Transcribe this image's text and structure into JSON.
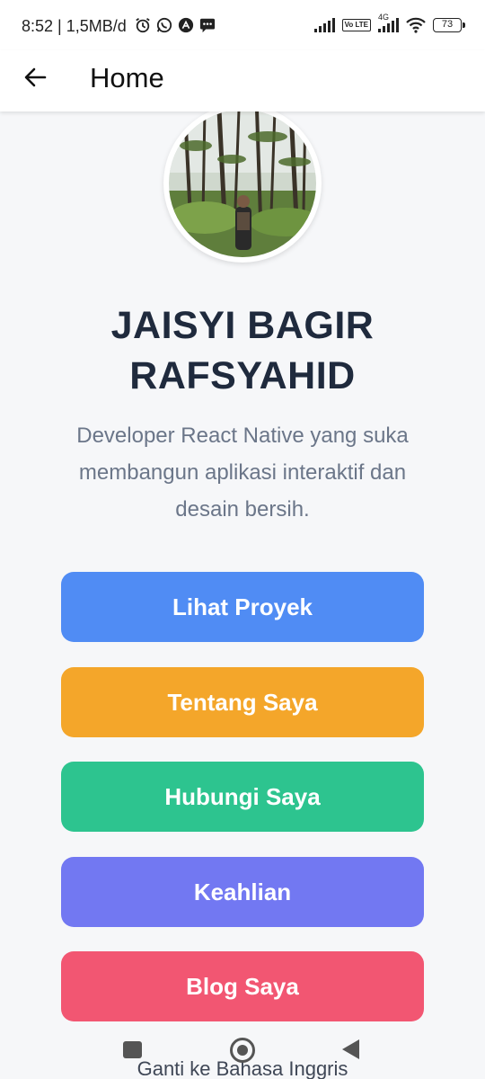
{
  "status_bar": {
    "time": "8:52 | 1,5MB/d",
    "icons": [
      "alarm-icon",
      "whatsapp-icon",
      "app-icon",
      "message-icon"
    ],
    "network_label": "4G",
    "volte_label": "Vo LTE",
    "battery": "73"
  },
  "header": {
    "title": "Home",
    "back_icon": "arrow-left-icon"
  },
  "profile": {
    "name": "JAISYI BAGIR RAFSYAHID",
    "bio": "Developer React Native yang suka membangun aplikasi interaktif dan desain bersih."
  },
  "buttons": [
    {
      "label": "Lihat Proyek",
      "color": "#508cf4"
    },
    {
      "label": "Tentang Saya",
      "color": "#f4a62a"
    },
    {
      "label": "Hubungi Saya",
      "color": "#2dc48f"
    },
    {
      "label": "Keahlian",
      "color": "#7278f2"
    },
    {
      "label": "Blog Saya",
      "color": "#f25672"
    }
  ],
  "footer": {
    "language_link": "Ganti ke Bahasa Inggris"
  },
  "navigation": {
    "icons": [
      "recent-apps-icon",
      "home-icon",
      "back-icon"
    ]
  }
}
